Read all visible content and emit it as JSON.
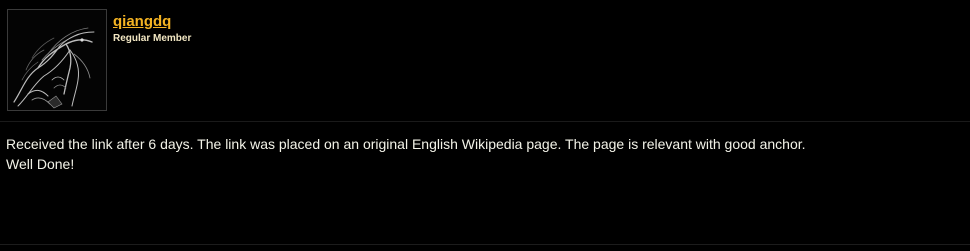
{
  "author": {
    "username": "qiangdq",
    "rank": "Regular Member",
    "avatar_icon": "dragon-avatar"
  },
  "post": {
    "line1": "Received the link after 6 days. The link was placed on an original English Wikipedia page. The page is relevant with good anchor.",
    "line2": "Well Done!"
  },
  "colors": {
    "background": "#000000",
    "username": "#f5b423",
    "text": "#f3f3e8"
  }
}
